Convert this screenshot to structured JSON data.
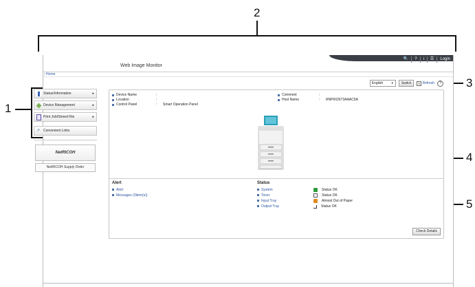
{
  "callouts": {
    "c1": "1",
    "c2": "2",
    "c3": "3",
    "c4": "4",
    "c5": "5"
  },
  "app": {
    "title": "Web Image Monitor",
    "toolbar": {
      "search": "🔍",
      "help": "?",
      "info": "i",
      "user": "☰",
      "login": "Login"
    },
    "breadcrumb": "› Home"
  },
  "lang": {
    "selected": "English",
    "switch_label": "Switch",
    "refresh_label": "Refresh",
    "help_label": "?"
  },
  "sidebar": {
    "items": [
      {
        "label": "Status/Information"
      },
      {
        "label": "Device Management"
      },
      {
        "label": "Print Job/Stored File"
      }
    ],
    "convenient": "Convenient Links",
    "logo": "NetRICOH",
    "supply": "NetRICOH Supply Order"
  },
  "device": {
    "left": [
      {
        "key": "Device Name",
        "value": ""
      },
      {
        "key": "Location",
        "value": ""
      },
      {
        "key": "Control Panel",
        "value": "Smart Operation Panel"
      }
    ],
    "right": [
      {
        "key": "Comment",
        "value": ""
      },
      {
        "key": "Host Name",
        "value": "RNP002673AAAC5A"
      }
    ]
  },
  "alert": {
    "heading": "Alert",
    "links": [
      "Alert",
      "Messages (0item(s))"
    ]
  },
  "status": {
    "heading": "Status",
    "rows": [
      {
        "name": "System",
        "value": "Status OK",
        "icon": "status-ok-icon",
        "color": "#2e9a3a"
      },
      {
        "name": "Toner",
        "value": "Status OK",
        "icon": "toner-icon",
        "color": "#555555"
      },
      {
        "name": "Input Tray",
        "value": "Almost Out of Paper",
        "icon": "warning-icon",
        "color": "#e08a1e"
      },
      {
        "name": "Output Tray",
        "value": "Status OK",
        "icon": "output-tray-icon",
        "color": "#333333"
      }
    ],
    "check_details": "Check Details"
  }
}
